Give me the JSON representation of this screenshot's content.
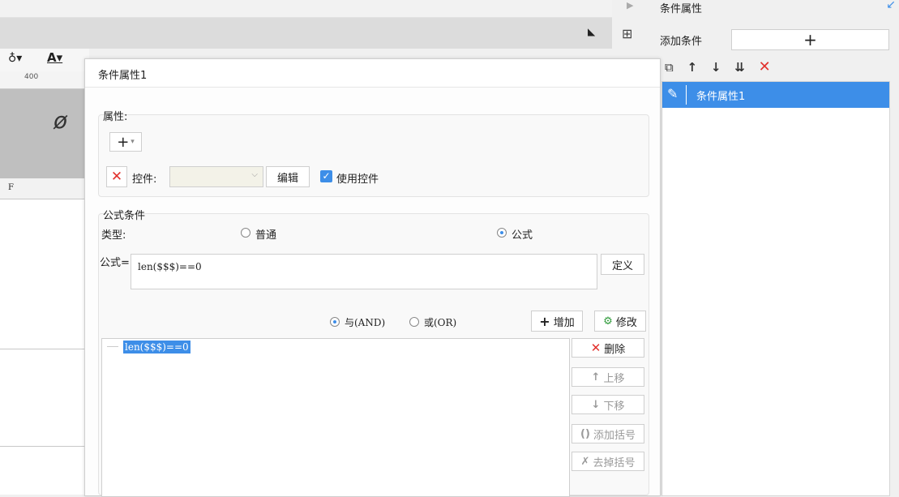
{
  "background": {
    "ruler_value": "400",
    "column_label": "F"
  },
  "right_panel": {
    "title": "条件属性",
    "add_condition_label": "添加条件",
    "add_button": "+",
    "list_items": [
      "条件属性1"
    ]
  },
  "dialog": {
    "title": "条件属性1",
    "attributes_group_label": "属性:",
    "add_attr_button": "+",
    "control_label": "控件:",
    "control_value": "",
    "edit_button": "编辑",
    "use_control_label": "使用控件",
    "use_control_checked": true,
    "formula_group_label": "公式条件",
    "type_label": "类型:",
    "type_options": [
      "普通",
      "公式"
    ],
    "type_selected": "公式",
    "formula_label": "公式=",
    "formula_value": "len($$$)==0",
    "define_button": "定义",
    "logic_options": [
      "与(AND)",
      "或(OR)"
    ],
    "logic_selected": "与(AND)",
    "add_button": "增加",
    "modify_button": "修改",
    "conditions": [
      "len($$$)==0"
    ],
    "delete_button": "删除",
    "move_up_button": "上移",
    "move_down_button": "下移",
    "add_bracket_button": "添加括号",
    "remove_bracket_button": "去掉括号"
  },
  "colors": {
    "accent": "#3d8ee8",
    "danger": "#e2312d"
  }
}
